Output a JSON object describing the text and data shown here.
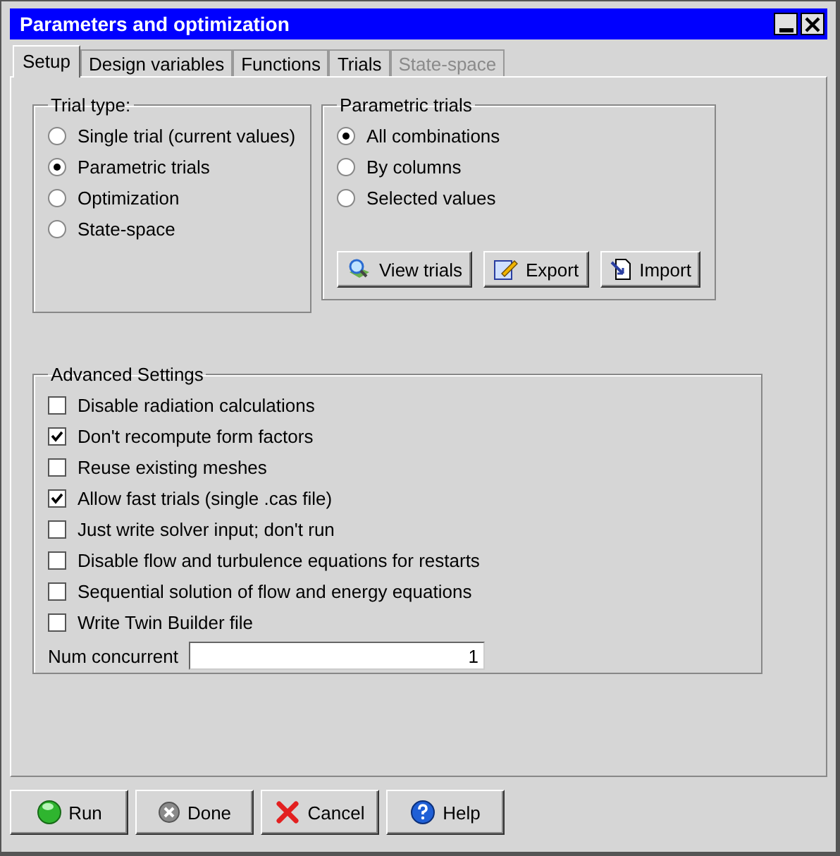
{
  "window": {
    "title": "Parameters and optimization"
  },
  "tabs": [
    {
      "label": "Setup",
      "selected": true,
      "disabled": false
    },
    {
      "label": "Design variables",
      "selected": false,
      "disabled": false
    },
    {
      "label": "Functions",
      "selected": false,
      "disabled": false
    },
    {
      "label": "Trials",
      "selected": false,
      "disabled": false
    },
    {
      "label": "State-space",
      "selected": false,
      "disabled": true
    }
  ],
  "trial_type": {
    "title": "Trial type:",
    "options": [
      {
        "label": "Single trial (current values)",
        "selected": false
      },
      {
        "label": "Parametric trials",
        "selected": true
      },
      {
        "label": "Optimization",
        "selected": false
      },
      {
        "label": "State-space",
        "selected": false
      }
    ]
  },
  "parametric_trials": {
    "title": "Parametric trials",
    "options": [
      {
        "label": "All combinations",
        "selected": true
      },
      {
        "label": "By columns",
        "selected": false
      },
      {
        "label": "Selected values",
        "selected": false
      }
    ],
    "buttons": [
      {
        "label": "View trials",
        "kind": "view"
      },
      {
        "label": "Export",
        "kind": "export"
      },
      {
        "label": "Import",
        "kind": "import"
      }
    ]
  },
  "advanced": {
    "title": "Advanced Settings",
    "options": [
      {
        "label": "Disable radiation calculations",
        "checked": false
      },
      {
        "label": "Don't recompute form factors",
        "checked": true
      },
      {
        "label": "Reuse existing meshes",
        "checked": false
      },
      {
        "label": "Allow fast trials (single .cas file)",
        "checked": true
      },
      {
        "label": "Just write solver input; don't run",
        "checked": false
      },
      {
        "label": "Disable flow and turbulence equations for restarts",
        "checked": false
      },
      {
        "label": "Sequential solution of flow and energy equations",
        "checked": false
      },
      {
        "label": "Write Twin Builder file",
        "checked": false
      }
    ],
    "num_concurrent": {
      "label": "Num concurrent",
      "value": "1"
    }
  },
  "buttons": [
    {
      "label": "Run",
      "kind": "run"
    },
    {
      "label": "Done",
      "kind": "done"
    },
    {
      "label": "Cancel",
      "kind": "cancel"
    },
    {
      "label": "Help",
      "kind": "help"
    }
  ]
}
